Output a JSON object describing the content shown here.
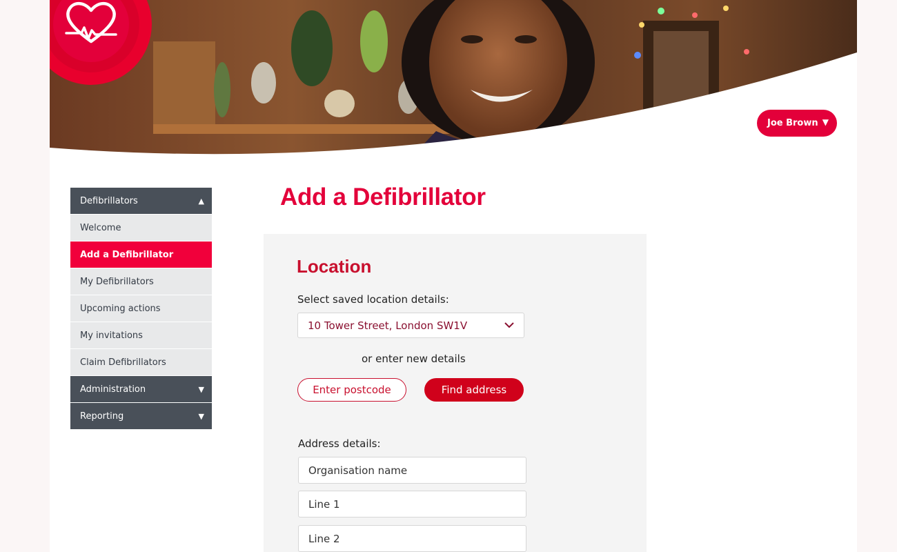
{
  "header": {
    "user_name": "Joe Brown",
    "user_caret": "▼",
    "logo": "heart-logo"
  },
  "sidebar": {
    "items": [
      {
        "label": "Defibrillators",
        "type": "header",
        "caret": "▲"
      },
      {
        "label": "Welcome",
        "type": "item"
      },
      {
        "label": "Add a Defibrillator",
        "type": "active"
      },
      {
        "label": "My Defibrillators",
        "type": "item"
      },
      {
        "label": "Upcoming actions",
        "type": "item"
      },
      {
        "label": "My invitations",
        "type": "item"
      },
      {
        "label": "Claim Defibrillators",
        "type": "item"
      },
      {
        "label": "Administration",
        "type": "header",
        "caret": "▼"
      },
      {
        "label": "Reporting",
        "type": "header",
        "caret": "▼"
      }
    ]
  },
  "main": {
    "title": "Add a Defibrillator",
    "section_title": "Location",
    "saved_location_label": "Select saved location details:",
    "saved_location_value": "10 Tower Street, London SW1V",
    "or_text": "or enter new details",
    "enter_postcode_label": "Enter postcode",
    "find_address_label": "Find address",
    "address_label": "Address details:",
    "fields": {
      "organisation_placeholder": "Organisation name",
      "line1_placeholder": "Line 1",
      "line2_placeholder": "Line 2"
    }
  },
  "colors": {
    "brand_red": "#e3003a",
    "sidebar_header": "#495059",
    "sidebar_item": "#e8e9ea"
  }
}
